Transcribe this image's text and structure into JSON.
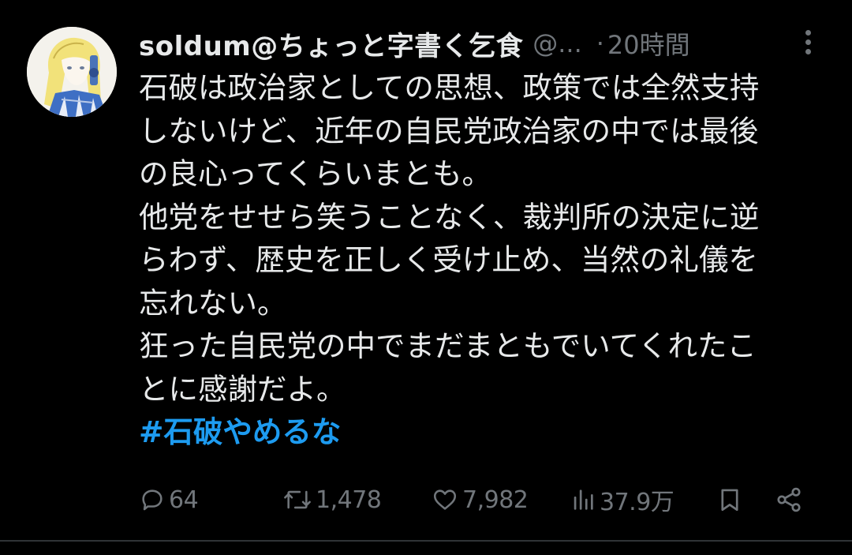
{
  "tweet": {
    "display_name": "soldum@ちょっと字書く乞食",
    "handle": "@...",
    "separator": "·",
    "time": "20時間",
    "lines": [
      "石破は政治家としての思想、政策では全然支持",
      "しないけど、近年の自民党政治家の中では最後",
      "の良心ってくらいまとも。",
      "他党をせせら笑うことなく、裁判所の決定に逆",
      "らわず、歴史を正しく受け止め、当然の礼儀を",
      "忘れない。",
      "狂った自民党の中でまだまともでいてくれたこ",
      "とに感謝だよ。"
    ],
    "hashtag": "#石破やめるな"
  },
  "actions": {
    "replies": "64",
    "retweets": "1,478",
    "likes": "7,982",
    "views": "37.9万"
  },
  "colors": {
    "background": "#000000",
    "text": "#e7e9ea",
    "muted": "#71767b",
    "hashtag": "#1d9bf0"
  },
  "icons": {
    "reply": "reply-icon",
    "retweet": "retweet-icon",
    "like": "heart-icon",
    "views": "views-icon",
    "bookmark": "bookmark-icon",
    "share": "share-icon",
    "more": "more-dots-icon"
  }
}
